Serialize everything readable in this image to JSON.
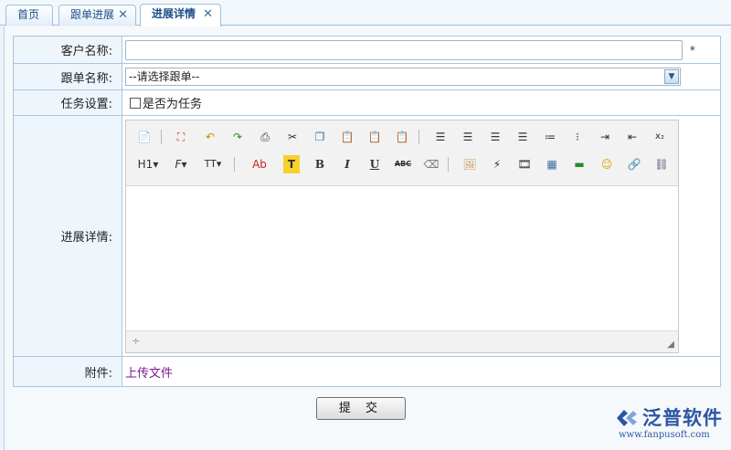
{
  "tabs": [
    {
      "label": "首页",
      "closable": false,
      "active": false
    },
    {
      "label": "跟单进展",
      "closable": true,
      "active": false
    },
    {
      "label": "进展详情",
      "closable": true,
      "active": true
    }
  ],
  "form": {
    "customer_label": "客户名称:",
    "customer_value": "",
    "required_mark": "*",
    "followup_label": "跟单名称:",
    "followup_selected": "--请选择跟单--",
    "task_label": "任务设置:",
    "task_checkbox_label": "是否为任务",
    "task_checked": false,
    "detail_label": "进展详情:",
    "attachment_label": "附件:",
    "upload_link": "上传文件"
  },
  "editor_toolbar": {
    "row1": [
      "source-icon",
      "preview-icon",
      "undo-icon",
      "redo-icon",
      "print-icon",
      "cut-icon",
      "copy-icon",
      "paste-icon",
      "paste-text-icon",
      "paste-word-icon",
      "align-left-icon",
      "align-center-icon",
      "align-right-icon",
      "justify-icon",
      "ordered-list-icon",
      "unordered-list-icon",
      "indent-icon",
      "outdent-icon",
      "subscript-icon"
    ],
    "row2_text": {
      "heading": "H1",
      "font": "F",
      "fontsize": "TT",
      "color": "Ab",
      "highlight": "T",
      "bold": "B",
      "italic": "I",
      "underline": "U",
      "strike": "ABC"
    },
    "row2_icons": [
      "eraser-icon",
      "image-icon",
      "flash-icon",
      "media-icon",
      "table-icon",
      "hr-icon",
      "emoticon-icon",
      "link-icon",
      "unlink-icon"
    ]
  },
  "submit_label": "提 交",
  "logo": {
    "brand": "泛普软件",
    "url": "www.fanpusoft.com"
  },
  "colors": {
    "accent": "#1b4f8a",
    "border": "#a9c6df",
    "label_bg": "#eef5fb",
    "link": "#7a1c8c",
    "logo": "#2c55a3"
  }
}
